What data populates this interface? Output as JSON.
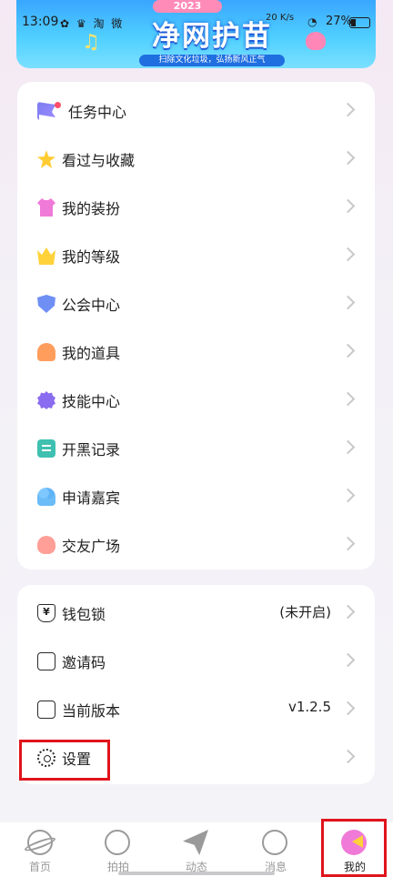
{
  "status_bar": {
    "time": "13:09",
    "battery": "27%",
    "left_icons": "✿ ♛ 淘 微",
    "right_icons": "20\nK/s"
  },
  "banner": {
    "year": "2023",
    "title": "净网护苗",
    "subtitle": "扫除文化垃圾，弘扬新风正气"
  },
  "menu": {
    "items": [
      {
        "label": "任务中心",
        "icon": "flag-icon",
        "badge": true
      },
      {
        "label": "看过与收藏",
        "icon": "star-icon"
      },
      {
        "label": "我的装扮",
        "icon": "shirt-icon"
      },
      {
        "label": "我的等级",
        "icon": "crown-icon"
      },
      {
        "label": "公会中心",
        "icon": "shield-icon"
      },
      {
        "label": "我的道具",
        "icon": "bell-icon"
      },
      {
        "label": "技能中心",
        "icon": "badge-icon"
      },
      {
        "label": "开黑记录",
        "icon": "note-icon"
      },
      {
        "label": "申请嘉宾",
        "icon": "people-icon"
      },
      {
        "label": "交友广场",
        "icon": "heart-icon"
      }
    ]
  },
  "settings": {
    "items": [
      {
        "label": "钱包锁",
        "value": "(未开启)",
        "icon": "wallet-lock-icon"
      },
      {
        "label": "邀请码",
        "value": "",
        "icon": "ticket-icon"
      },
      {
        "label": "当前版本",
        "value": "v1.2.5",
        "icon": "document-icon"
      },
      {
        "label": "设置",
        "value": "",
        "icon": "gear-icon"
      }
    ]
  },
  "nav": {
    "items": [
      {
        "label": "首页",
        "icon": "planet-icon"
      },
      {
        "label": "拍拍",
        "icon": "shoot-icon"
      },
      {
        "label": "动态",
        "icon": "paper-plane-icon"
      },
      {
        "label": "消息",
        "icon": "chat-icon"
      },
      {
        "label": "我的",
        "icon": "profile-icon",
        "active": true
      }
    ]
  }
}
